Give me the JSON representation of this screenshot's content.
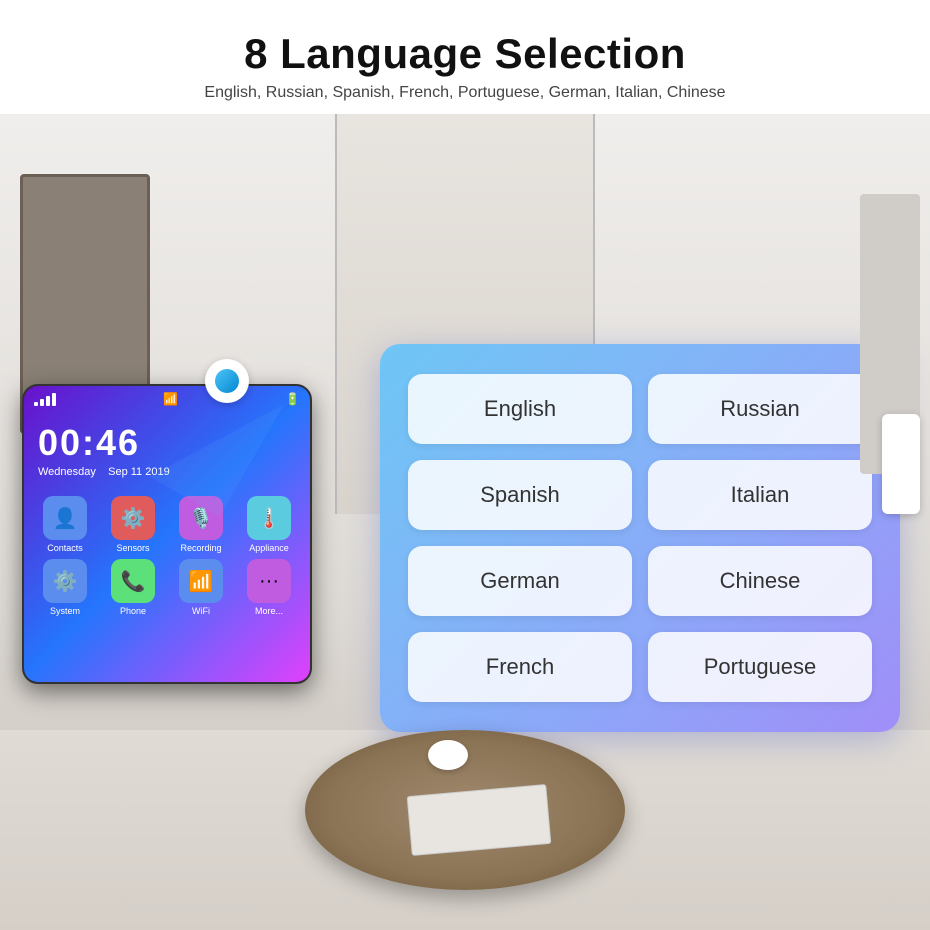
{
  "header": {
    "title": "8 Language Selection",
    "subtitle": "English, Russian, Spanish, French, Portuguese, German, Italian, Chinese"
  },
  "panel": {
    "time": "00:46",
    "day": "Wednesday",
    "date": "Sep 11 2019",
    "apps": [
      {
        "label": "Contacts",
        "icon": "👤",
        "color": "#5b8dee"
      },
      {
        "label": "Sensors",
        "icon": "⚙️",
        "color": "#e05c5c"
      },
      {
        "label": "Recording",
        "icon": "🎙️",
        "color": "#c05ce0"
      },
      {
        "label": "Appliance",
        "icon": "🌡️",
        "color": "#5bcce0"
      },
      {
        "label": "System",
        "icon": "⚙️",
        "color": "#5b8dee"
      },
      {
        "label": "Phone",
        "icon": "📞",
        "color": "#5be07a"
      },
      {
        "label": "WiFi",
        "icon": "📶",
        "color": "#5b8dee"
      },
      {
        "label": "More...",
        "icon": "•••",
        "color": "#c05ce0"
      }
    ]
  },
  "languages": {
    "buttons": [
      {
        "id": "english",
        "label": "English"
      },
      {
        "id": "russian",
        "label": "Russian"
      },
      {
        "id": "spanish",
        "label": "Spanish"
      },
      {
        "id": "italian",
        "label": "Italian"
      },
      {
        "id": "german",
        "label": "German"
      },
      {
        "id": "chinese",
        "label": "Chinese"
      },
      {
        "id": "french",
        "label": "French"
      },
      {
        "id": "portuguese",
        "label": "Portuguese"
      }
    ]
  }
}
